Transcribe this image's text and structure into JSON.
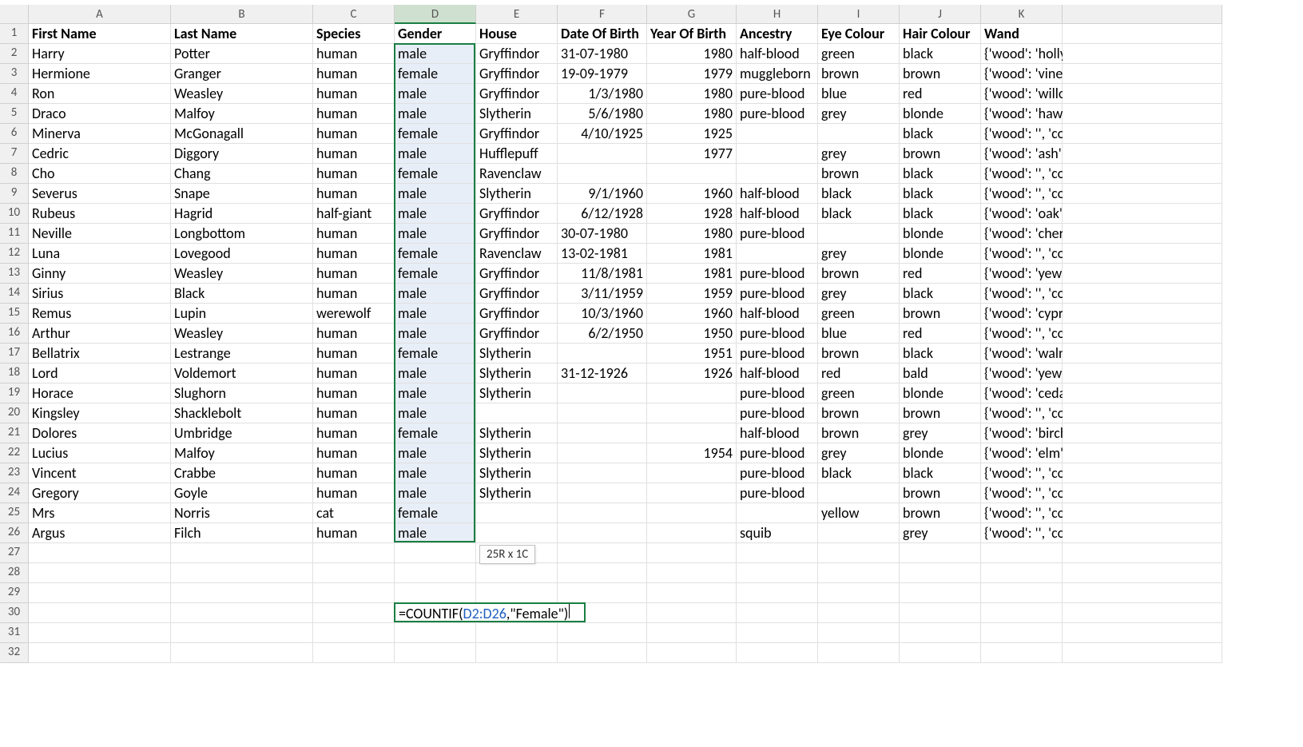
{
  "columns": [
    "A",
    "B",
    "C",
    "D",
    "E",
    "F",
    "G",
    "H",
    "I",
    "J",
    "K"
  ],
  "headers": {
    "A": "First Name",
    "B": "Last Name",
    "C": "Species",
    "D": "Gender",
    "E": "House",
    "F": "Date Of Birth",
    "G": "Year Of Birth",
    "H": "Ancestry",
    "I": "Eye Colour",
    "J": "Hair Colour",
    "K": "Wand"
  },
  "rows": [
    {
      "A": "Harry",
      "B": "Potter",
      "C": "human",
      "D": "male",
      "E": "Gryffindor",
      "F": "31-07-1980",
      "G": "1980",
      "H": "half-blood",
      "I": "green",
      "J": "black",
      "K": "{'wood': 'holly', 'core': 'phoe"
    },
    {
      "A": "Hermione",
      "B": "Granger",
      "C": "human",
      "D": "female",
      "E": "Gryffindor",
      "F": "19-09-1979",
      "G": "1979",
      "H": "muggleborn",
      "I": "brown",
      "J": "brown",
      "K": "{'wood': 'vine', 'core': 'drago"
    },
    {
      "A": "Ron",
      "B": "Weasley",
      "C": "human",
      "D": "male",
      "E": "Gryffindor",
      "F": "1/3/1980",
      "F_align": "r",
      "G": "1980",
      "H": "pure-blood",
      "I": "blue",
      "J": "red",
      "K": "{'wood': 'willow', 'core': 'uni"
    },
    {
      "A": "Draco",
      "B": "Malfoy",
      "C": "human",
      "D": "male",
      "E": "Slytherin",
      "F": "5/6/1980",
      "F_align": "r",
      "G": "1980",
      "H": "pure-blood",
      "I": "grey",
      "J": "blonde",
      "K": "{'wood': 'hawthorn', 'core': '"
    },
    {
      "A": "Minerva",
      "B": "McGonagall",
      "C": "human",
      "D": "female",
      "E": "Gryffindor",
      "F": "4/10/1925",
      "F_align": "r",
      "G": "1925",
      "H": "",
      "I": "",
      "J": "black",
      "K": "{'wood': '', 'core': '', 'length':"
    },
    {
      "A": "Cedric",
      "B": "Diggory",
      "C": "human",
      "D": "male",
      "E": "Hufflepuff",
      "F": "",
      "G": "1977",
      "H": "",
      "I": "grey",
      "J": "brown",
      "K": "{'wood': 'ash', 'core': 'unicor"
    },
    {
      "A": "Cho",
      "B": "Chang",
      "C": "human",
      "D": "female",
      "E": "Ravenclaw",
      "F": "",
      "G": "",
      "H": "",
      "I": "brown",
      "J": "black",
      "K": "{'wood': '', 'core': '', 'length':"
    },
    {
      "A": "Severus",
      "B": "Snape",
      "C": "human",
      "D": "male",
      "E": "Slytherin",
      "F": "9/1/1960",
      "F_align": "r",
      "G": "1960",
      "H": "half-blood",
      "I": "black",
      "J": "black",
      "K": "{'wood': '', 'core': '', 'length':"
    },
    {
      "A": "Rubeus",
      "B": "Hagrid",
      "C": "half-giant",
      "D": "male",
      "E": "Gryffindor",
      "F": "6/12/1928",
      "F_align": "r",
      "G": "1928",
      "H": "half-blood",
      "I": "black",
      "J": "black",
      "K": "{'wood': 'oak', 'core': '', 'leng"
    },
    {
      "A": "Neville",
      "B": "Longbottom",
      "C": "human",
      "D": "male",
      "E": "Gryffindor",
      "F": "30-07-1980",
      "G": "1980",
      "H": "pure-blood",
      "I": "",
      "J": "blonde",
      "K": "{'wood': 'cherry', 'core': 'uni"
    },
    {
      "A": "Luna",
      "B": "Lovegood",
      "C": "human",
      "D": "female",
      "E": "Ravenclaw",
      "F": "13-02-1981",
      "G": "1981",
      "H": "",
      "I": "grey",
      "J": "blonde",
      "K": "{'wood': '', 'core': '', 'length':"
    },
    {
      "A": "Ginny",
      "B": "Weasley",
      "C": "human",
      "D": "female",
      "E": "Gryffindor",
      "F": "11/8/1981",
      "F_align": "r",
      "G": "1981",
      "H": "pure-blood",
      "I": "brown",
      "J": "red",
      "K": "{'wood': 'yew', 'core': '', 'leng"
    },
    {
      "A": "Sirius",
      "B": "Black",
      "C": "human",
      "D": "male",
      "E": "Gryffindor",
      "F": "3/11/1959",
      "F_align": "r",
      "G": "1959",
      "H": "pure-blood",
      "I": "grey",
      "J": "black",
      "K": "{'wood': '', 'core': '', 'length':"
    },
    {
      "A": "Remus",
      "B": "Lupin",
      "C": "werewolf",
      "D": "male",
      "E": "Gryffindor",
      "F": "10/3/1960",
      "F_align": "r",
      "G": "1960",
      "H": "half-blood",
      "I": "green",
      "J": "brown",
      "K": "{'wood': 'cypress', 'core': 'ur"
    },
    {
      "A": "Arthur",
      "B": "Weasley",
      "C": "human",
      "D": "male",
      "E": "Gryffindor",
      "F": "6/2/1950",
      "F_align": "r",
      "G": "1950",
      "H": "pure-blood",
      "I": "blue",
      "J": "red",
      "K": "{'wood': '', 'core': '', 'length':"
    },
    {
      "A": "Bellatrix",
      "B": "Lestrange",
      "C": "human",
      "D": "female",
      "E": "Slytherin",
      "F": "",
      "G": "1951",
      "H": "pure-blood",
      "I": "brown",
      "J": "black",
      "K": "{'wood': 'walnut', 'core': 'dra"
    },
    {
      "A": "Lord",
      "B": "Voldemort",
      "C": "human",
      "D": "male",
      "E": "Slytherin",
      "F": "31-12-1926",
      "G": "1926",
      "H": "half-blood",
      "I": "red",
      "J": "bald",
      "K": "{'wood': 'yew', 'core': 'phoer"
    },
    {
      "A": "Horace",
      "B": "Slughorn",
      "C": "human",
      "D": "male",
      "E": "Slytherin",
      "F": "",
      "G": "",
      "H": "pure-blood",
      "I": "green",
      "J": "blonde",
      "K": "{'wood': 'cedar', 'core': 'drag"
    },
    {
      "A": "Kingsley",
      "B": "Shacklebolt",
      "C": "human",
      "D": "male",
      "E": "",
      "F": "",
      "G": "",
      "H": "pure-blood",
      "I": "brown",
      "J": "brown",
      "K": "{'wood': '', 'core': '', 'length':"
    },
    {
      "A": "Dolores",
      "B": "Umbridge",
      "C": "human",
      "D": "female",
      "E": "Slytherin",
      "F": "",
      "G": "",
      "H": "half-blood",
      "I": "brown",
      "J": "grey",
      "K": "{'wood': 'birch', 'core': 'drag"
    },
    {
      "A": "Lucius",
      "B": "Malfoy",
      "C": "human",
      "D": "male",
      "E": "Slytherin",
      "F": "",
      "G": "1954",
      "H": "pure-blood",
      "I": "grey",
      "J": "blonde",
      "K": "{'wood': 'elm', 'core': 'drago"
    },
    {
      "A": "Vincent",
      "B": "Crabbe",
      "C": "human",
      "D": "male",
      "E": "Slytherin",
      "F": "",
      "G": "",
      "H": "pure-blood",
      "I": "black",
      "J": "black",
      "K": "{'wood': '', 'core': '', 'length':"
    },
    {
      "A": "Gregory",
      "B": "Goyle",
      "C": "human",
      "D": "male",
      "E": "Slytherin",
      "F": "",
      "G": "",
      "H": "pure-blood",
      "I": "",
      "J": "brown",
      "K": "{'wood': '', 'core': '', 'length':"
    },
    {
      "A": "Mrs",
      "B": "Norris",
      "C": "cat",
      "D": "female",
      "E": "",
      "F": "",
      "G": "",
      "H": "",
      "I": "yellow",
      "J": "brown",
      "K": "{'wood': '', 'core': '', 'length':"
    },
    {
      "A": "Argus",
      "B": "Filch",
      "C": "human",
      "D": "male",
      "E": "",
      "F": "",
      "G": "",
      "H": "squib",
      "I": "",
      "J": "grey",
      "K": "{'wood': '', 'core': '', 'length':"
    }
  ],
  "empty_rows": [
    27,
    28,
    29,
    30,
    31,
    32
  ],
  "selection": {
    "range": "D2:D26",
    "tooltip": "25R x 1C"
  },
  "formula": {
    "prefix": "=COUNTIF(",
    "ref": "D2:D26",
    "suffix": ",\"Female\")",
    "cell": "D30"
  },
  "colors": {
    "selection_border": "#1a7e43",
    "range_fill": "#e8eef7",
    "ref_color": "#2060c0"
  }
}
